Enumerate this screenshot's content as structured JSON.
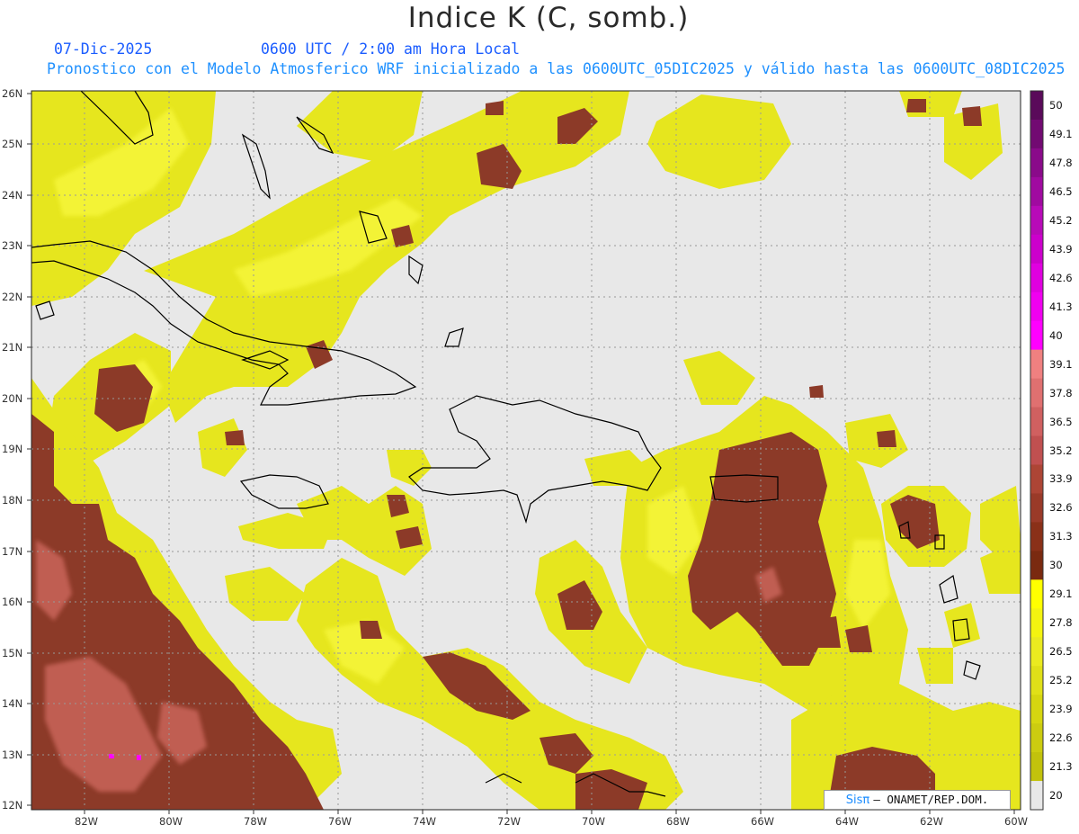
{
  "header": {
    "title": "Indice K (C, somb.)",
    "date": "07-Dic-2025",
    "time": "0600 UTC / 2:00 am Hora Local",
    "description": "Pronostico con el Modelo Atmosferico WRF inicializado a las 0600UTC_05DIC2025 y válido hasta las  0600UTC_08DIC2025"
  },
  "axes": {
    "lat_labels": [
      "26N",
      "25N",
      "24N",
      "23N",
      "22N",
      "21N",
      "20N",
      "19N",
      "18N",
      "17N",
      "16N",
      "15N",
      "14N",
      "13N",
      "12N"
    ],
    "lon_labels": [
      "82W",
      "80W",
      "78W",
      "76W",
      "74W",
      "72W",
      "70W",
      "68W",
      "66W",
      "64W",
      "62W",
      "60W"
    ]
  },
  "colorbar": {
    "labels": [
      "50",
      "49.1",
      "47.8",
      "46.5",
      "45.2",
      "43.9",
      "42.6",
      "41.3",
      "40",
      "39.1",
      "37.8",
      "36.5",
      "35.2",
      "33.9",
      "32.6",
      "31.3",
      "30",
      "29.1",
      "27.8",
      "26.5",
      "25.2",
      "23.9",
      "22.6",
      "21.3",
      "20"
    ],
    "colors": [
      "#5a0a5a",
      "#720a72",
      "#8a0a8a",
      "#a00aa0",
      "#b80ab8",
      "#cc00cc",
      "#e000e0",
      "#f000f0",
      "#ff00ff",
      "#f08080",
      "#e07070",
      "#d06060",
      "#c05050",
      "#ad4535",
      "#9a3a28",
      "#8a3018",
      "#7a2a10",
      "#ffff00",
      "#f4f410",
      "#eaea20",
      "#e0e018",
      "#d6d610",
      "#cccc10",
      "#c2c20c",
      "#e8e8e8"
    ]
  },
  "credit": {
    "brand": "Sisπ",
    "org": "– ONAMET/REP.DOM."
  },
  "colors": {
    "background": "#e8e8e8",
    "k_low": "#e4e41c",
    "k_mid": "#f4f41e",
    "k_high": "#8a3a26",
    "k_very_high": "#d06a60",
    "coast": "#000000"
  }
}
